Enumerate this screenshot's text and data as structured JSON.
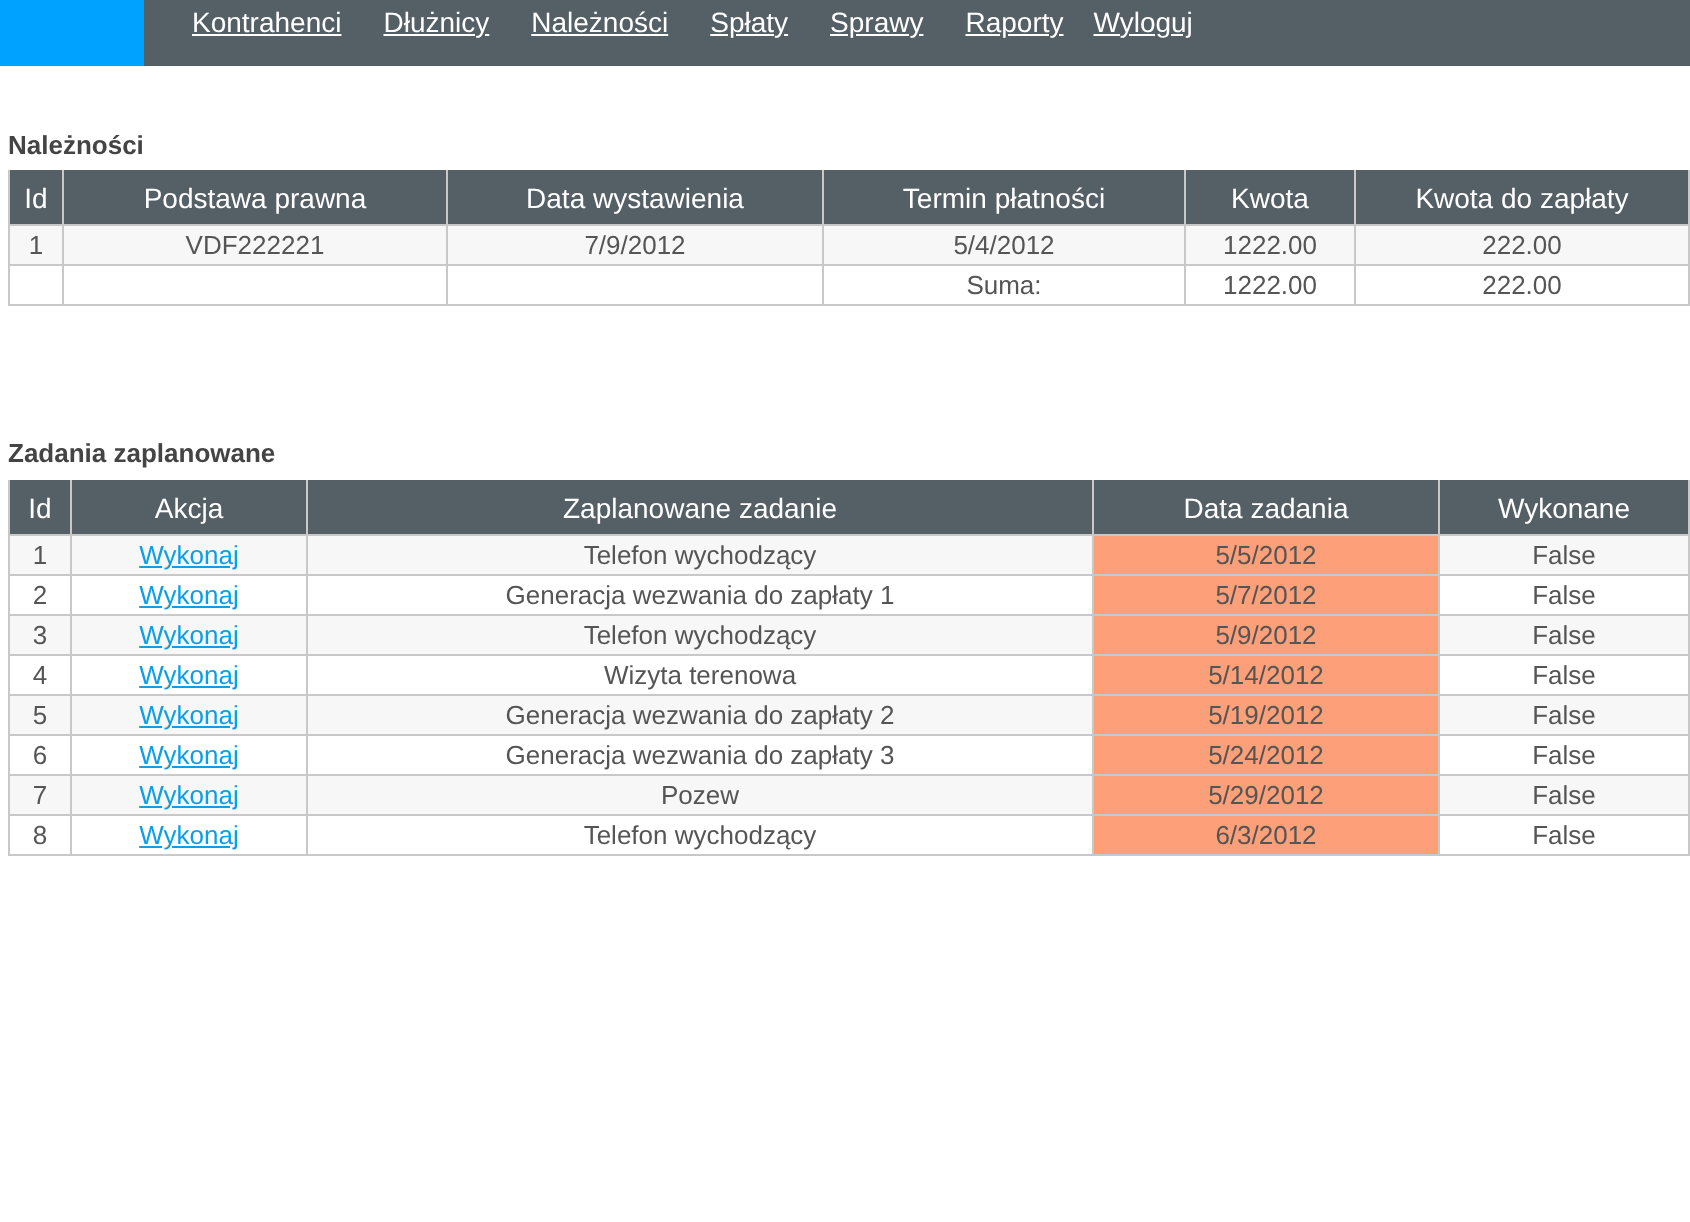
{
  "nav": [
    "Kontrahenci",
    "Dłużnicy",
    "Należności",
    "Spłaty",
    "Sprawy",
    "Raporty",
    "Wyloguj"
  ],
  "receivables": {
    "title": "Należności",
    "columns": [
      "Id",
      "Podstawa prawna",
      "Data wystawienia",
      "Termin płatności",
      "Kwota",
      "Kwota do zapłaty"
    ],
    "rows": [
      [
        "1",
        "VDF222221",
        "7/9/2012",
        "5/4/2012",
        "1222.00",
        "222.00"
      ]
    ],
    "total": {
      "label": "Suma:",
      "amount": "1222.00",
      "due": "222.00"
    }
  },
  "tasks": {
    "title": "Zadania zaplanowane",
    "columns": [
      "Id",
      "Akcja",
      "Zaplanowane zadanie",
      "Data zadania",
      "Wykonane"
    ],
    "rows": [
      {
        "id": "1",
        "action": "Wykonaj",
        "task": "Telefon wychodzący",
        "date": "5/5/2012",
        "overdue": true,
        "done": "False"
      },
      {
        "id": "2",
        "action": "Wykonaj",
        "task": "Generacja wezwania do zapłaty 1",
        "date": "5/7/2012",
        "overdue": true,
        "done": "False"
      },
      {
        "id": "3",
        "action": "Wykonaj",
        "task": "Telefon wychodzący",
        "date": "5/9/2012",
        "overdue": true,
        "done": "False"
      },
      {
        "id": "4",
        "action": "Wykonaj",
        "task": "Wizyta terenowa",
        "date": "5/14/2012",
        "overdue": true,
        "done": "False"
      },
      {
        "id": "5",
        "action": "Wykonaj",
        "task": "Generacja wezwania do zapłaty 2",
        "date": "5/19/2012",
        "overdue": true,
        "done": "False"
      },
      {
        "id": "6",
        "action": "Wykonaj",
        "task": "Generacja wezwania do zapłaty 3",
        "date": "5/24/2012",
        "overdue": true,
        "done": "False"
      },
      {
        "id": "7",
        "action": "Wykonaj",
        "task": "Pozew",
        "date": "5/29/2012",
        "overdue": true,
        "done": "False"
      },
      {
        "id": "8",
        "action": "Wykonaj",
        "task": "Telefon wychodzący",
        "date": "6/3/2012",
        "overdue": true,
        "done": "False"
      }
    ]
  }
}
